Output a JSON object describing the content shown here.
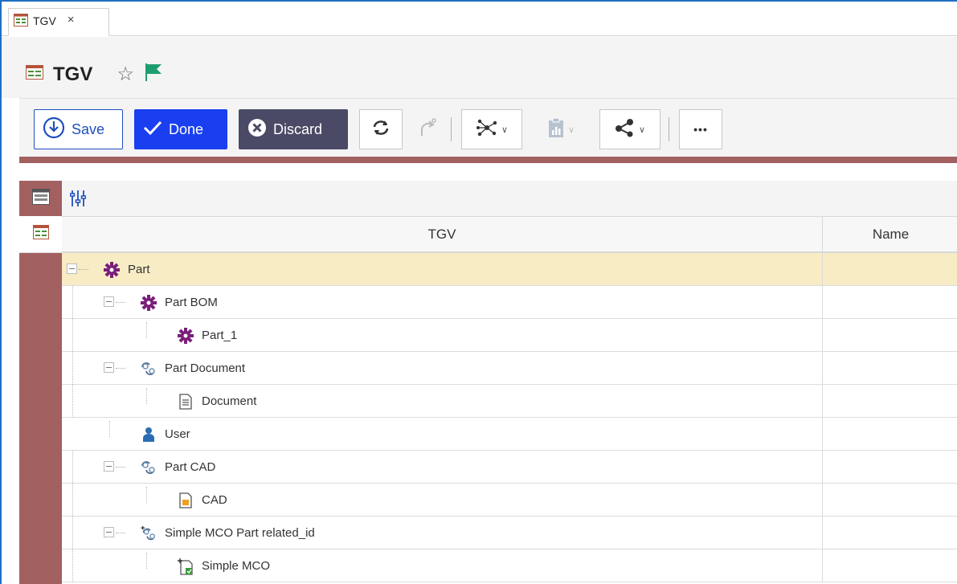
{
  "tab": {
    "label": "TGV",
    "close": "×"
  },
  "header": {
    "title": "TGV"
  },
  "toolbar": {
    "save_label": "Save",
    "done_label": "Done",
    "discard_label": "Discard",
    "more_label": "•••"
  },
  "grid": {
    "columns": [
      "TGV",
      "Name"
    ],
    "rows": [
      {
        "label": "Part",
        "level": 0,
        "icon": "gear-icon",
        "expandable": true,
        "selected": true,
        "name": ""
      },
      {
        "label": "Part BOM",
        "level": 1,
        "icon": "gear-icon",
        "expandable": true,
        "selected": false,
        "name": ""
      },
      {
        "label": "Part_1",
        "level": 2,
        "icon": "gear-icon",
        "expandable": false,
        "selected": false,
        "name": ""
      },
      {
        "label": "Part Document",
        "level": 1,
        "icon": "relationship-icon",
        "expandable": true,
        "selected": false,
        "name": ""
      },
      {
        "label": "Document",
        "level": 2,
        "icon": "document-icon",
        "expandable": false,
        "selected": false,
        "name": ""
      },
      {
        "label": "User",
        "level": 1,
        "icon": "user-icon",
        "expandable": false,
        "selected": false,
        "name": ""
      },
      {
        "label": "Part CAD",
        "level": 1,
        "icon": "relationship-icon",
        "expandable": true,
        "selected": false,
        "name": ""
      },
      {
        "label": "CAD",
        "level": 2,
        "icon": "cad-file-icon",
        "expandable": false,
        "selected": false,
        "name": ""
      },
      {
        "label": "Simple MCO Part related_id",
        "level": 1,
        "icon": "mco-relationship-icon",
        "expandable": true,
        "selected": false,
        "name": ""
      },
      {
        "label": "Simple MCO",
        "level": 2,
        "icon": "mco-icon",
        "expandable": false,
        "selected": false,
        "name": ""
      }
    ]
  },
  "colors": {
    "accent": "#1a3ff0",
    "rail": "#a26060",
    "selected_row": "#f8ecc4",
    "gear": "#7a1f7a",
    "flag": "#1e9e6e"
  }
}
